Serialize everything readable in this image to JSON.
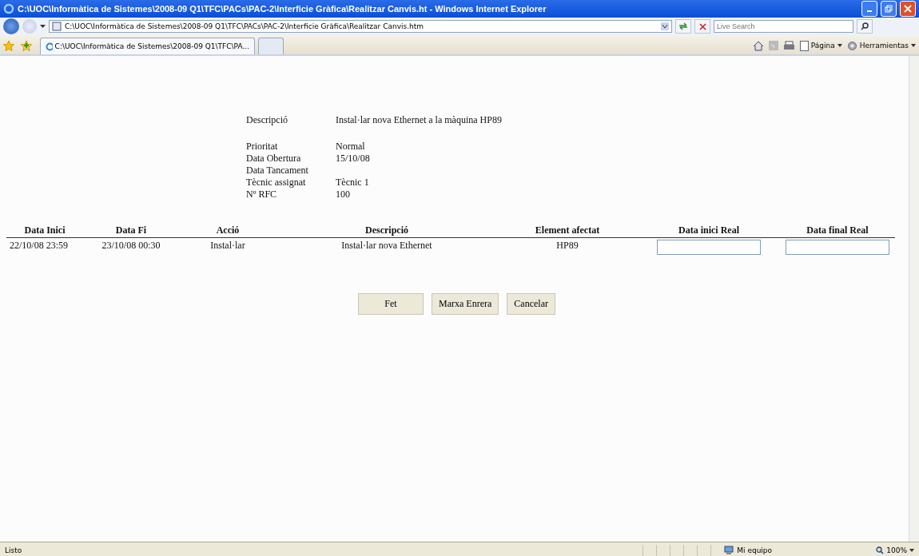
{
  "window": {
    "title": "C:\\UOC\\Informàtica de Sistemes\\2008-09 Q1\\TFC\\PACs\\PAC-2\\Interficie Gràfica\\Realitzar Canvis.ht - Windows Internet Explorer"
  },
  "address_bar": {
    "value": "C:\\UOC\\Informàtica de Sistemes\\2008-09 Q1\\TFC\\PACs\\PAC-2\\Interficie Gràfica\\Realitzar Canvis.htm"
  },
  "search": {
    "placeholder": "Live Search"
  },
  "tabs": [
    {
      "label": "C:\\UOC\\Informàtica de Sistemes\\2008-09 Q1\\TFC\\PA...",
      "selected": true
    }
  ],
  "command_bar": [
    "Página",
    "Herramientas"
  ],
  "details": [
    {
      "label": "Descripció",
      "value": "Instal·lar nova Ethernet a la màquina HP89"
    },
    {
      "label": "Prioritat",
      "value": "Normal"
    },
    {
      "label": "Data Obertura",
      "value": "15/10/08"
    },
    {
      "label": "Data Tancament"
    },
    {
      "label": "Tècnic assignat",
      "value": "Tècnic 1"
    },
    {
      "label": "Nº RFC",
      "value": "100"
    }
  ],
  "table": {
    "columns": [
      "Data Inici",
      "Data Fi",
      "Acció",
      "Descripció",
      "Element afectat",
      "Data inici Real",
      "Data final Real"
    ],
    "rows": [
      {
        "cells": [
          "22/10/08 23:59",
          "23/10/08 00:30",
          "Instal·lar",
          "Instal·lar nova Ethernet",
          "HP89"
        ]
      }
    ]
  },
  "buttons": [
    "Fet",
    "Marxa Enrera",
    "Cancelar"
  ],
  "status_bar": {
    "text": "Listo",
    "zone": "Mi equipo",
    "zoom": "100%"
  }
}
